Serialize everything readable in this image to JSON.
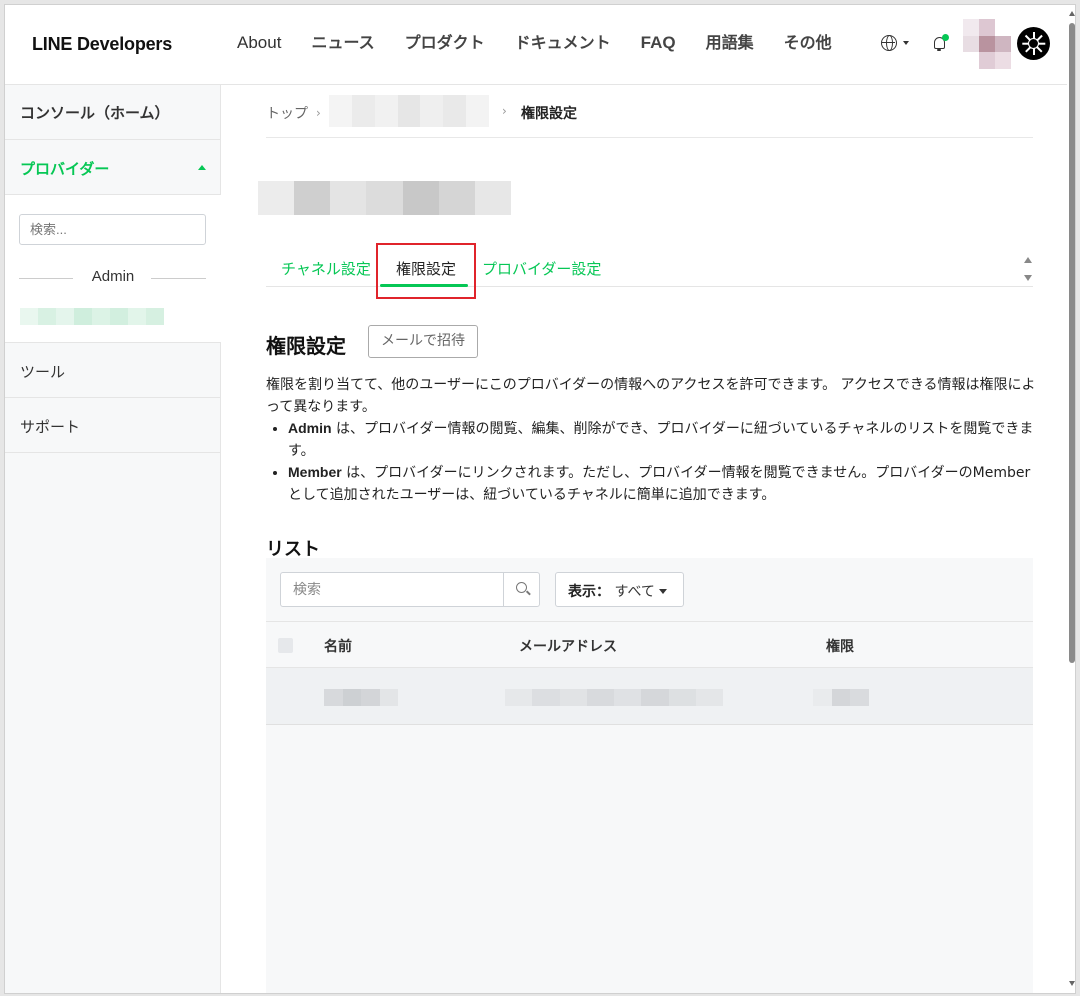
{
  "header": {
    "logo": "LINE Developers",
    "nav": [
      "About",
      "ニュース",
      "プロダクト",
      "ドキュメント",
      "FAQ",
      "用語集",
      "その他"
    ]
  },
  "sidebar": {
    "home": "コンソール（ホーム）",
    "provider": "プロバイダー",
    "search_placeholder": "検索...",
    "role_group": "Admin",
    "tools": "ツール",
    "support": "サポート"
  },
  "breadcrumb": {
    "top": "トップ",
    "current": "権限設定"
  },
  "tabs": [
    "チャネル設定",
    "権限設定",
    "プロバイダー設定"
  ],
  "active_tab_index": 1,
  "section": {
    "title": "権限設定",
    "invite_button": "メールで招待",
    "description": "権限を割り当てて、他のユーザーにこのプロバイダーの情報へのアクセスを許可できます。 アクセスできる情報は権限によって異なります。",
    "roles": [
      {
        "name": "Admin",
        "text": " は、プロバイダー情報の閲覧、編集、削除ができ、プロバイダーに紐づいているチャネルのリストを閲覧できます。"
      },
      {
        "name": "Member",
        "text": " は、プロバイダーにリンクされます。ただし、プロバイダー情報を閲覧できません。プロバイダーのMemberとして追加されたユーザーは、紐づいているチャネルに簡単に追加できます。"
      }
    ]
  },
  "list": {
    "title": "リスト",
    "search_placeholder": "検索",
    "filter_label": "表示：",
    "filter_value": "すべて",
    "columns": [
      "名前",
      "メールアドレス",
      "権限"
    ]
  },
  "colors": {
    "accent": "#06c755",
    "highlight": "#e0242b"
  }
}
